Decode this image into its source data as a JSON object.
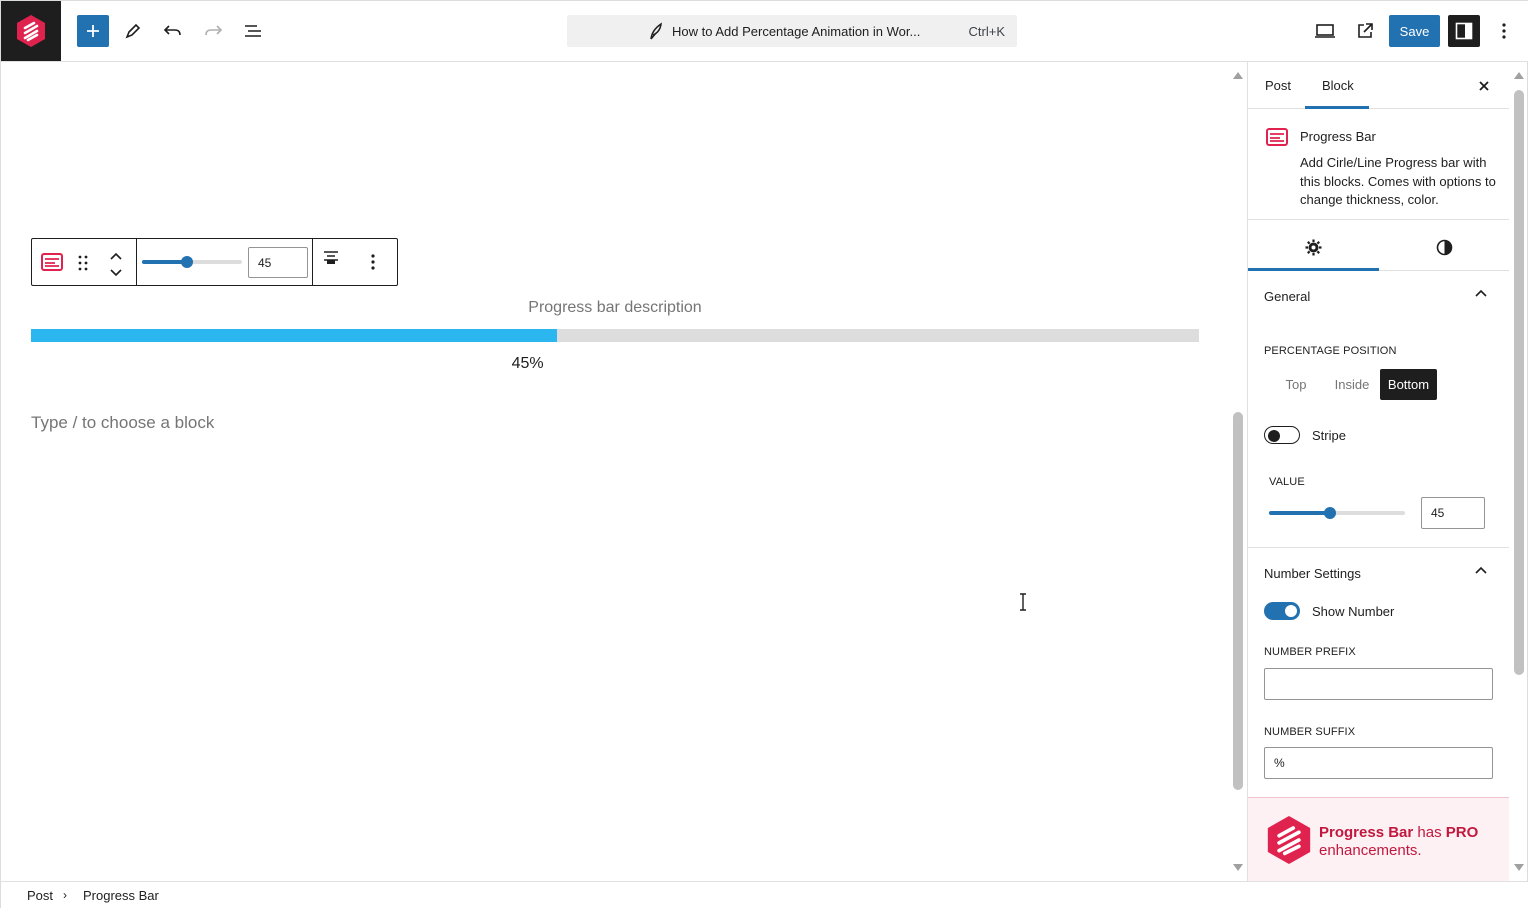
{
  "header": {
    "document_title": "How to Add Percentage Animation in Wor...",
    "shortcut": "Ctrl+K",
    "save_label": "Save"
  },
  "editor": {
    "toolbar_value": "45",
    "progress": {
      "description": "Progress bar description",
      "value_fraction": 0.45,
      "percent_label": "45%",
      "fill_color": "#2bb6f0"
    },
    "placeholder": "Type / to choose a block"
  },
  "sidebar": {
    "tabs": [
      "Post",
      "Block"
    ],
    "active_tab": "Block",
    "block": {
      "title": "Progress Bar",
      "description": "Add Cirle/Line Progress bar with this blocks. Comes with options to change thickness, color."
    },
    "general": {
      "title": "General",
      "percentage_position_label": "PERCENTAGE POSITION",
      "positions": [
        "Top",
        "Inside",
        "Bottom"
      ],
      "selected_position": "Bottom",
      "stripe_label": "Stripe",
      "stripe_on": false,
      "value_label": "VALUE",
      "value": "45",
      "value_fraction": 0.45
    },
    "number_settings": {
      "title": "Number Settings",
      "show_number_label": "Show Number",
      "show_number_on": true,
      "prefix_label": "NUMBER PREFIX",
      "prefix_value": "",
      "suffix_label": "NUMBER SUFFIX",
      "suffix_value": "%"
    },
    "promo": {
      "name": "Progress Bar",
      "has": "has",
      "pro": "PRO",
      "rest": "enhancements."
    }
  },
  "breadcrumb": [
    "Post",
    "Progress Bar"
  ],
  "colors": {
    "accent": "#2271b1",
    "brand": "#e0234e"
  }
}
